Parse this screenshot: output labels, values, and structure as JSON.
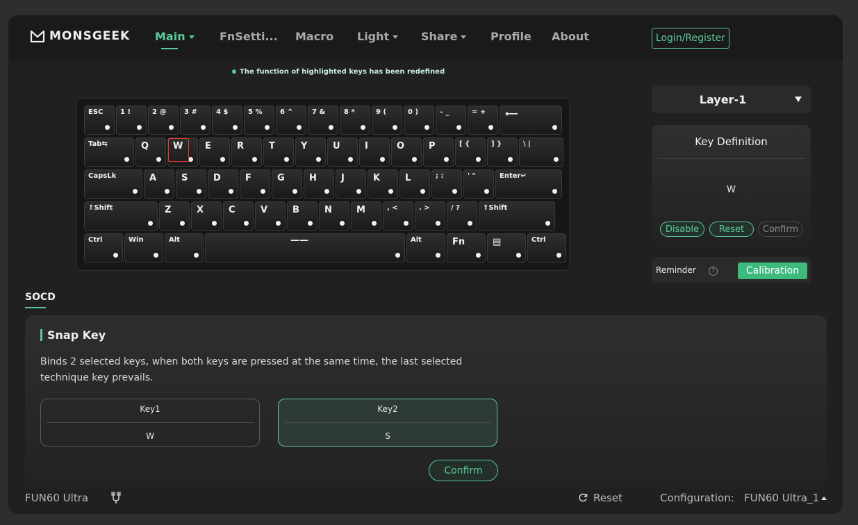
{
  "brand": {
    "name": "MONSGEEK"
  },
  "nav": {
    "items": [
      {
        "label": "Main"
      },
      {
        "label": "FnSetti..."
      },
      {
        "label": "Macro"
      },
      {
        "label": "Light"
      },
      {
        "label": "Share"
      },
      {
        "label": "Profile"
      },
      {
        "label": "About"
      }
    ],
    "login": "Login/Register"
  },
  "notice": "The function of highlighted keys has been redefined",
  "keyboard": {
    "rows": [
      [
        "ESC",
        "1 !",
        "2 @",
        "3 #",
        "4 $",
        "5 %",
        "6 ^",
        "7 &",
        "8 *",
        "9 (",
        "0 )",
        "– _",
        "= +",
        "⟵"
      ],
      [
        "Tab⇆",
        "Q",
        "W",
        "E",
        "R",
        "T",
        "Y",
        "U",
        "I",
        "O",
        "P",
        "[ {",
        "] }",
        "\\ |"
      ],
      [
        "CapsLk",
        "A",
        "S",
        "D",
        "F",
        "G",
        "H",
        "J",
        "K",
        "L",
        "; :",
        "' \"",
        "Enter↵"
      ],
      [
        "⇑Shift",
        "Z",
        "X",
        "C",
        "V",
        "B",
        "N",
        "M",
        ", <",
        ". >",
        "/ ?",
        "⇑Shift"
      ],
      [
        "Ctrl",
        "Win",
        "Alt",
        "——",
        "Alt",
        "Fn",
        "▤",
        "Ctrl"
      ]
    ],
    "highlighted_key": "W"
  },
  "layer": {
    "selected": "Layer-1"
  },
  "key_definition": {
    "title": "Key Definition",
    "value": "W",
    "disable": "Disable",
    "reset": "Reset",
    "confirm": "Confirm"
  },
  "reminder": {
    "label": "Reminder",
    "help": "?",
    "calibration": "Calibration"
  },
  "socd": {
    "tab": "SOCD",
    "title": "Snap Key",
    "description": "Binds 2 selected keys, when both keys are pressed at the same time, the last selected technique key prevails.",
    "key1": {
      "label": "Key1",
      "value": "W"
    },
    "key2": {
      "label": "Key2",
      "value": "S"
    },
    "confirm": "Confirm"
  },
  "status": {
    "device": "FUN60 Ultra",
    "reset": "Reset",
    "config_label": "Configuration:",
    "config_value": "FUN60 Ultra_1"
  },
  "colors": {
    "accent": "#5cc99a",
    "highlight": "#e23a3a",
    "calibration": "#3dbb7d"
  }
}
